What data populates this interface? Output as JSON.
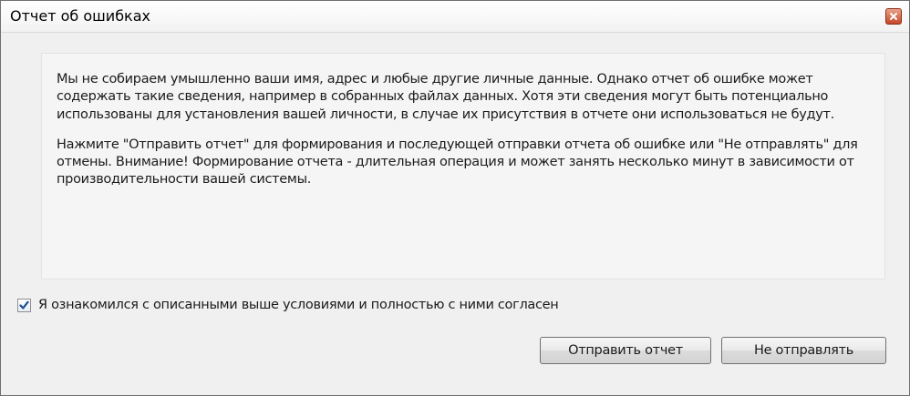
{
  "window": {
    "title": "Отчет об ошибках",
    "close_icon": "close-icon"
  },
  "info": {
    "paragraph1": "Мы не собираем умышленно ваши имя, адрес и любые другие личные данные. Однако отчет об ошибке может содержать такие сведения, например в собранных файлах данных. Хотя эти сведения могут быть потенциально использованы для установления вашей личности, в случае их присутствия в отчете они использоваться не будут.",
    "paragraph2": "Нажмите \"Отправить отчет\" для формирования и последующей отправки отчета об ошибке или \"Не отправлять\" для отмены. Внимание! Формирование отчета - длительная операция и может занять несколько минут в зависимости от производительности вашей системы."
  },
  "agreement": {
    "checked": true,
    "label": "Я ознакомился с описанными выше условиями и полностью с ними согласен"
  },
  "buttons": {
    "send_label": "Отправить отчет",
    "cancel_label": "Не отправлять"
  },
  "colors": {
    "close_button": "#c7462a",
    "checkmark": "#1d4f91"
  }
}
